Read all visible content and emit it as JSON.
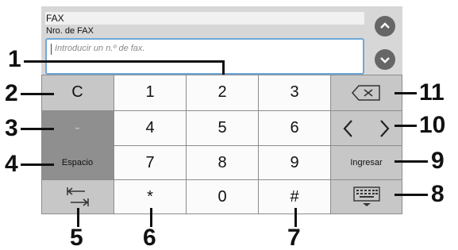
{
  "header": {
    "field_title": "FAX",
    "field_subtitle": "Nro. de FAX",
    "input_placeholder": "Introducir un n.º de fax."
  },
  "keys": {
    "clear": "C",
    "k1": "1",
    "k2": "2",
    "k3": "3",
    "dash": "-",
    "k4": "4",
    "k5": "5",
    "k6": "6",
    "space": "Espacio",
    "k7": "7",
    "k8": "8",
    "k9": "9",
    "enter": "Ingresar",
    "star": "*",
    "k0": "0",
    "hash": "#"
  },
  "icons": {
    "scroll_up": "chevron-up-icon",
    "scroll_down": "chevron-down-icon",
    "backspace": "backspace-icon",
    "cursor_left": "chevron-left-icon",
    "cursor_right": "chevron-right-icon",
    "tab": "tab-icon",
    "keyboard": "keyboard-icon"
  },
  "callouts": {
    "n1": "1",
    "n2": "2",
    "n3": "3",
    "n4": "4",
    "n5": "5",
    "n6": "6",
    "n7": "7",
    "n8": "8",
    "n9": "9",
    "n10": "10",
    "n11": "11"
  },
  "colors": {
    "panel": "#d7d7d7",
    "input_border": "#6fa8d8",
    "scroll_button": "#666666",
    "gray_key": "#c7c7c7",
    "dark_key": "#8f8f8f"
  }
}
